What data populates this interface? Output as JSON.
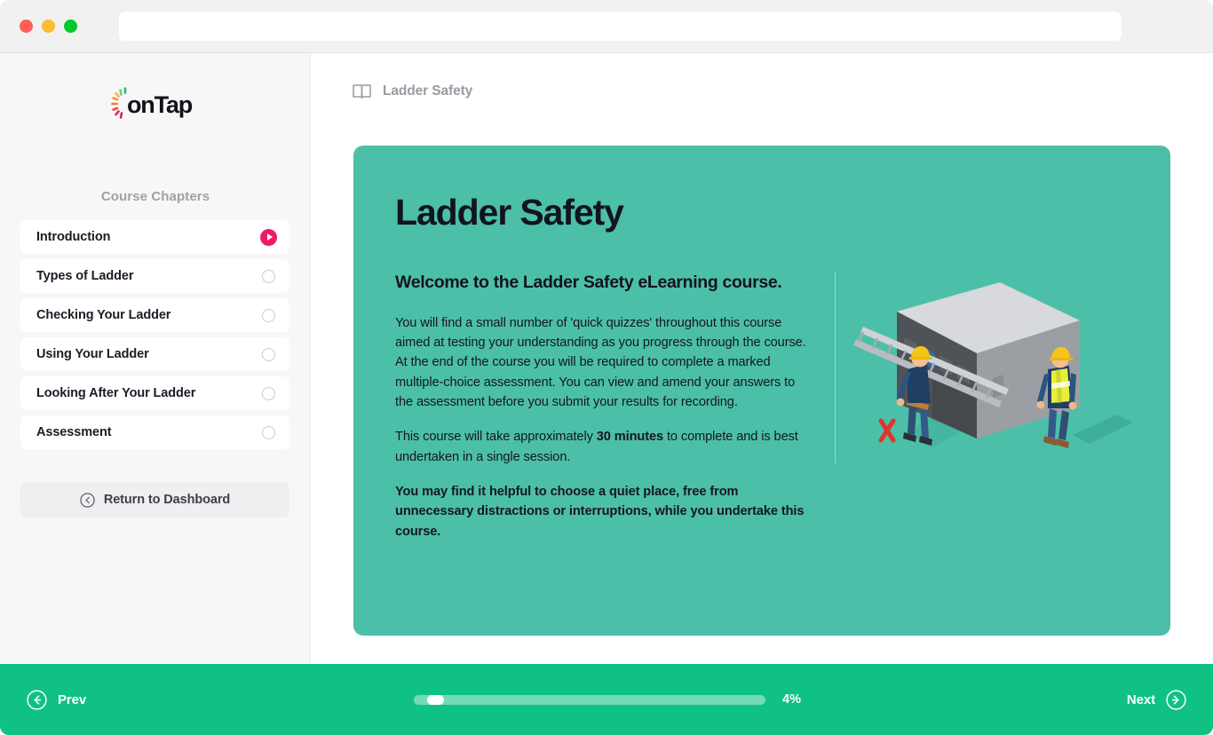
{
  "browser": {
    "traffic_lights": [
      "close-red",
      "minimize-yellow",
      "maximize-green"
    ],
    "address_value": "",
    "address_placeholder": ""
  },
  "sidebar": {
    "logo_text": "onTap",
    "chapters_title": "Course Chapters",
    "chapters": [
      {
        "label": "Introduction",
        "status": "playing"
      },
      {
        "label": "Types of Ladder",
        "status": "incomplete"
      },
      {
        "label": "Checking Your Ladder",
        "status": "incomplete"
      },
      {
        "label": "Using Your Ladder",
        "status": "incomplete"
      },
      {
        "label": "Looking After Your Ladder",
        "status": "incomplete"
      },
      {
        "label": "Assessment",
        "status": "incomplete"
      }
    ],
    "return_button": "Return to Dashboard"
  },
  "main": {
    "breadcrumb": "Ladder Safety",
    "card": {
      "title": "Ladder Safety",
      "subtitle": "Welcome to the Ladder Safety eLearning course.",
      "para1": "You will find a small number of 'quick quizzes' throughout this course aimed at testing your understanding as you progress through the course.  At the end of the course you will be required to complete a marked multiple-choice assessment. You can view and amend your answers to the assessment before you submit your results for recording.",
      "para2_pre": "This course will take approximately ",
      "para2_bold": "30 minutes",
      "para2_post": " to complete and is best undertaken in a single session.",
      "para3": "You may find it helpful to choose a quiet place, free from unnecessary distractions or interruptions, while you undertake this course.",
      "illustration_alt": "Two construction workers in hard hats carrying a ladder past a grey building, with a red cross mark"
    }
  },
  "footer": {
    "prev_label": "Prev",
    "next_label": "Next",
    "progress_percent_label": "4%",
    "progress_percent_value": 4
  },
  "colors": {
    "card_teal": "#4cbfa8",
    "footer_green": "#0fc283",
    "accent_pink": "#ec1a68",
    "sidebar_bg": "#f7f7f8",
    "text_dark": "#12141d",
    "text_muted": "#9a9aa2"
  }
}
